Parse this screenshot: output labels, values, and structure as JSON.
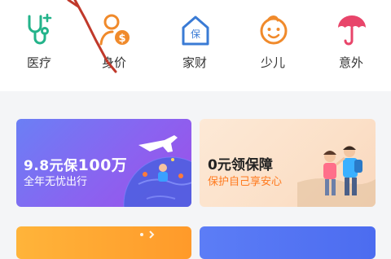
{
  "categories": [
    {
      "label": "医疗",
      "icon": "medical-icon"
    },
    {
      "label": "身价",
      "icon": "life-value-icon"
    },
    {
      "label": "家财",
      "icon": "home-insurance-icon"
    },
    {
      "label": "少儿",
      "icon": "child-icon"
    },
    {
      "label": "意外",
      "icon": "accident-umbrella-icon"
    }
  ],
  "cards": [
    {
      "title_prefix": "9.8元保",
      "title_highlight": "100万",
      "subtitle": "全年无忧出行"
    },
    {
      "title": "0元领保障",
      "subtitle": "保护自己享安心"
    }
  ],
  "colors": {
    "medical": "#23b38a",
    "life_value": "#f08a2b",
    "home": "#3a7bd5",
    "child": "#f08a2b",
    "accident": "#e8456a",
    "card2_subtitle": "#ff7a1e"
  }
}
